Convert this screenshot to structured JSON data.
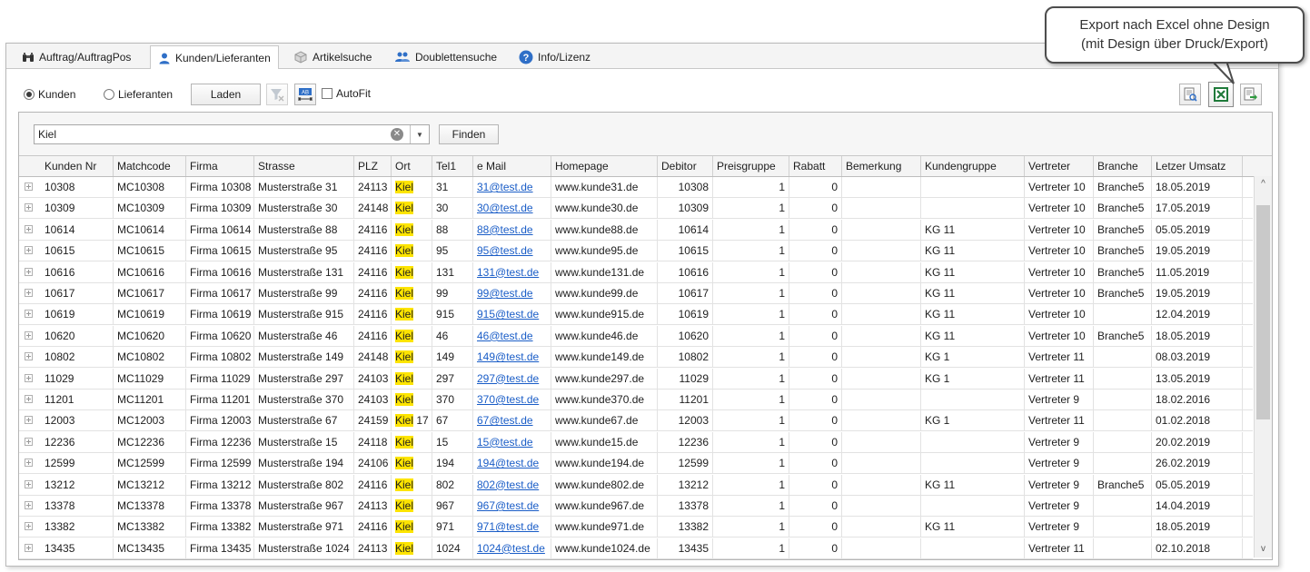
{
  "tabs": [
    {
      "label": "Auftrag/AuftragPos",
      "icon": "binoculars-icon",
      "active": false
    },
    {
      "label": "Kunden/Lieferanten",
      "icon": "user-icon",
      "active": true
    },
    {
      "label": "Artikelsuche",
      "icon": "cube-icon",
      "active": false
    },
    {
      "label": "Doublettensuche",
      "icon": "users-icon",
      "active": false
    },
    {
      "label": "Info/Lizenz",
      "icon": "help-icon",
      "active": false
    }
  ],
  "toolbar": {
    "radio_kunden": "Kunden",
    "radio_lieferanten": "Lieferanten",
    "selected": "Kunden",
    "load_label": "Laden",
    "autofit_label": "AutoFit",
    "autofit_checked": false
  },
  "search": {
    "value": "Kiel",
    "find_label": "Finden"
  },
  "callout": {
    "line1": "Export nach Excel ohne Design",
    "line2": "(mit Design über Druck/Export)"
  },
  "columns": [
    "Kunden Nr",
    "Matchcode",
    "Firma",
    "Strasse",
    "PLZ",
    "Ort",
    "Tel1",
    "e Mail",
    "Homepage",
    "Debitor",
    "Preisgruppe",
    "Rabatt",
    "Bemerkung",
    "Kundengruppe",
    "Vertreter",
    "Branche",
    "Letzer Umsatz"
  ],
  "rows": [
    {
      "nr": "10308",
      "mc": "MC10308",
      "firma": "Firma 10308",
      "str": "Musterstraße 31",
      "plz": "24113",
      "ort": "Kiel",
      "ort_rest": "",
      "tel": "31",
      "mail": "31@test.de",
      "hp": "www.kunde31.de",
      "deb": "10308",
      "pg": "1",
      "rab": "0",
      "bem": "",
      "kg": "",
      "ver": "Vertreter 10",
      "br": "Branche5",
      "um": "18.05.2019"
    },
    {
      "nr": "10309",
      "mc": "MC10309",
      "firma": "Firma 10309",
      "str": "Musterstraße 30",
      "plz": "24148",
      "ort": "Kiel",
      "ort_rest": "",
      "tel": "30",
      "mail": "30@test.de",
      "hp": "www.kunde30.de",
      "deb": "10309",
      "pg": "1",
      "rab": "0",
      "bem": "",
      "kg": "",
      "ver": "Vertreter 10",
      "br": "Branche5",
      "um": "17.05.2019"
    },
    {
      "nr": "10614",
      "mc": "MC10614",
      "firma": "Firma 10614",
      "str": "Musterstraße 88",
      "plz": "24116",
      "ort": "Kiel",
      "ort_rest": "",
      "tel": "88",
      "mail": "88@test.de",
      "hp": "www.kunde88.de",
      "deb": "10614",
      "pg": "1",
      "rab": "0",
      "bem": "",
      "kg": "KG 11",
      "ver": "Vertreter 10",
      "br": "Branche5",
      "um": "05.05.2019"
    },
    {
      "nr": "10615",
      "mc": "MC10615",
      "firma": "Firma 10615",
      "str": "Musterstraße 95",
      "plz": "24116",
      "ort": "Kiel",
      "ort_rest": "",
      "tel": "95",
      "mail": "95@test.de",
      "hp": "www.kunde95.de",
      "deb": "10615",
      "pg": "1",
      "rab": "0",
      "bem": "",
      "kg": "KG 11",
      "ver": "Vertreter 10",
      "br": "Branche5",
      "um": "19.05.2019"
    },
    {
      "nr": "10616",
      "mc": "MC10616",
      "firma": "Firma 10616",
      "str": "Musterstraße 131",
      "plz": "24116",
      "ort": "Kiel",
      "ort_rest": "",
      "tel": "131",
      "mail": "131@test.de",
      "hp": "www.kunde131.de",
      "deb": "10616",
      "pg": "1",
      "rab": "0",
      "bem": "",
      "kg": "KG 11",
      "ver": "Vertreter 10",
      "br": "Branche5",
      "um": "11.05.2019"
    },
    {
      "nr": "10617",
      "mc": "MC10617",
      "firma": "Firma 10617",
      "str": "Musterstraße 99",
      "plz": "24116",
      "ort": "Kiel",
      "ort_rest": "",
      "tel": "99",
      "mail": "99@test.de",
      "hp": "www.kunde99.de",
      "deb": "10617",
      "pg": "1",
      "rab": "0",
      "bem": "",
      "kg": "KG 11",
      "ver": "Vertreter 10",
      "br": "Branche5",
      "um": "19.05.2019"
    },
    {
      "nr": "10619",
      "mc": "MC10619",
      "firma": "Firma 10619",
      "str": "Musterstraße 915",
      "plz": "24116",
      "ort": "Kiel",
      "ort_rest": "",
      "tel": "915",
      "mail": "915@test.de",
      "hp": "www.kunde915.de",
      "deb": "10619",
      "pg": "1",
      "rab": "0",
      "bem": "",
      "kg": "KG 11",
      "ver": "Vertreter 10",
      "br": "",
      "um": "12.04.2019"
    },
    {
      "nr": "10620",
      "mc": "MC10620",
      "firma": "Firma 10620",
      "str": "Musterstraße 46",
      "plz": "24116",
      "ort": "Kiel",
      "ort_rest": "",
      "tel": "46",
      "mail": "46@test.de",
      "hp": "www.kunde46.de",
      "deb": "10620",
      "pg": "1",
      "rab": "0",
      "bem": "",
      "kg": "KG 11",
      "ver": "Vertreter 10",
      "br": "Branche5",
      "um": "18.05.2019"
    },
    {
      "nr": "10802",
      "mc": "MC10802",
      "firma": "Firma 10802",
      "str": "Musterstraße 149",
      "plz": "24148",
      "ort": "Kiel",
      "ort_rest": "",
      "tel": "149",
      "mail": "149@test.de",
      "hp": "www.kunde149.de",
      "deb": "10802",
      "pg": "1",
      "rab": "0",
      "bem": "",
      "kg": "KG 1",
      "ver": "Vertreter 11",
      "br": "",
      "um": "08.03.2019"
    },
    {
      "nr": "11029",
      "mc": "MC11029",
      "firma": "Firma 11029",
      "str": "Musterstraße 297",
      "plz": "24103",
      "ort": "Kiel",
      "ort_rest": "",
      "tel": "297",
      "mail": "297@test.de",
      "hp": "www.kunde297.de",
      "deb": "11029",
      "pg": "1",
      "rab": "0",
      "bem": "",
      "kg": "KG 1",
      "ver": "Vertreter 11",
      "br": "",
      "um": "13.05.2019"
    },
    {
      "nr": "11201",
      "mc": "MC11201",
      "firma": "Firma 11201",
      "str": "Musterstraße 370",
      "plz": "24103",
      "ort": "Kiel",
      "ort_rest": "",
      "tel": "370",
      "mail": "370@test.de",
      "hp": "www.kunde370.de",
      "deb": "11201",
      "pg": "1",
      "rab": "0",
      "bem": "",
      "kg": "",
      "ver": "Vertreter 9",
      "br": "",
      "um": "18.02.2016"
    },
    {
      "nr": "12003",
      "mc": "MC12003",
      "firma": "Firma 12003",
      "str": "Musterstraße 67",
      "plz": "24159",
      "ort": "Kiel",
      "ort_rest": " 17",
      "tel": "67",
      "mail": "67@test.de",
      "hp": "www.kunde67.de",
      "deb": "12003",
      "pg": "1",
      "rab": "0",
      "bem": "",
      "kg": "KG 1",
      "ver": "Vertreter 11",
      "br": "",
      "um": "01.02.2018"
    },
    {
      "nr": "12236",
      "mc": "MC12236",
      "firma": "Firma 12236",
      "str": "Musterstraße 15",
      "plz": "24118",
      "ort": "Kiel",
      "ort_rest": "",
      "tel": "15",
      "mail": "15@test.de",
      "hp": "www.kunde15.de",
      "deb": "12236",
      "pg": "1",
      "rab": "0",
      "bem": "",
      "kg": "",
      "ver": "Vertreter 9",
      "br": "",
      "um": "20.02.2019"
    },
    {
      "nr": "12599",
      "mc": "MC12599",
      "firma": "Firma 12599",
      "str": "Musterstraße 194",
      "plz": "24106",
      "ort": "Kiel",
      "ort_rest": "",
      "tel": "194",
      "mail": "194@test.de",
      "hp": "www.kunde194.de",
      "deb": "12599",
      "pg": "1",
      "rab": "0",
      "bem": "",
      "kg": "",
      "ver": "Vertreter 9",
      "br": "",
      "um": "26.02.2019"
    },
    {
      "nr": "13212",
      "mc": "MC13212",
      "firma": "Firma 13212",
      "str": "Musterstraße 802",
      "plz": "24116",
      "ort": "Kiel",
      "ort_rest": "",
      "tel": "802",
      "mail": "802@test.de",
      "hp": "www.kunde802.de",
      "deb": "13212",
      "pg": "1",
      "rab": "0",
      "bem": "",
      "kg": "KG 11",
      "ver": "Vertreter 9",
      "br": "Branche5",
      "um": "05.05.2019"
    },
    {
      "nr": "13378",
      "mc": "MC13378",
      "firma": "Firma 13378",
      "str": "Musterstraße 967",
      "plz": "24113",
      "ort": "Kiel",
      "ort_rest": "",
      "tel": "967",
      "mail": "967@test.de",
      "hp": "www.kunde967.de",
      "deb": "13378",
      "pg": "1",
      "rab": "0",
      "bem": "",
      "kg": "",
      "ver": "Vertreter 9",
      "br": "",
      "um": "14.04.2019"
    },
    {
      "nr": "13382",
      "mc": "MC13382",
      "firma": "Firma 13382",
      "str": "Musterstraße 971",
      "plz": "24116",
      "ort": "Kiel",
      "ort_rest": "",
      "tel": "971",
      "mail": "971@test.de",
      "hp": "www.kunde971.de",
      "deb": "13382",
      "pg": "1",
      "rab": "0",
      "bem": "",
      "kg": "KG 11",
      "ver": "Vertreter 9",
      "br": "",
      "um": "18.05.2019"
    },
    {
      "nr": "13435",
      "mc": "MC13435",
      "firma": "Firma 13435",
      "str": "Musterstraße 1024",
      "plz": "24113",
      "ort": "Kiel",
      "ort_rest": "",
      "tel": "1024",
      "mail": "1024@test.de",
      "hp": "www.kunde1024.de",
      "deb": "13435",
      "pg": "1",
      "rab": "0",
      "bem": "",
      "kg": "",
      "ver": "Vertreter 11",
      "br": "",
      "um": "02.10.2018"
    }
  ]
}
